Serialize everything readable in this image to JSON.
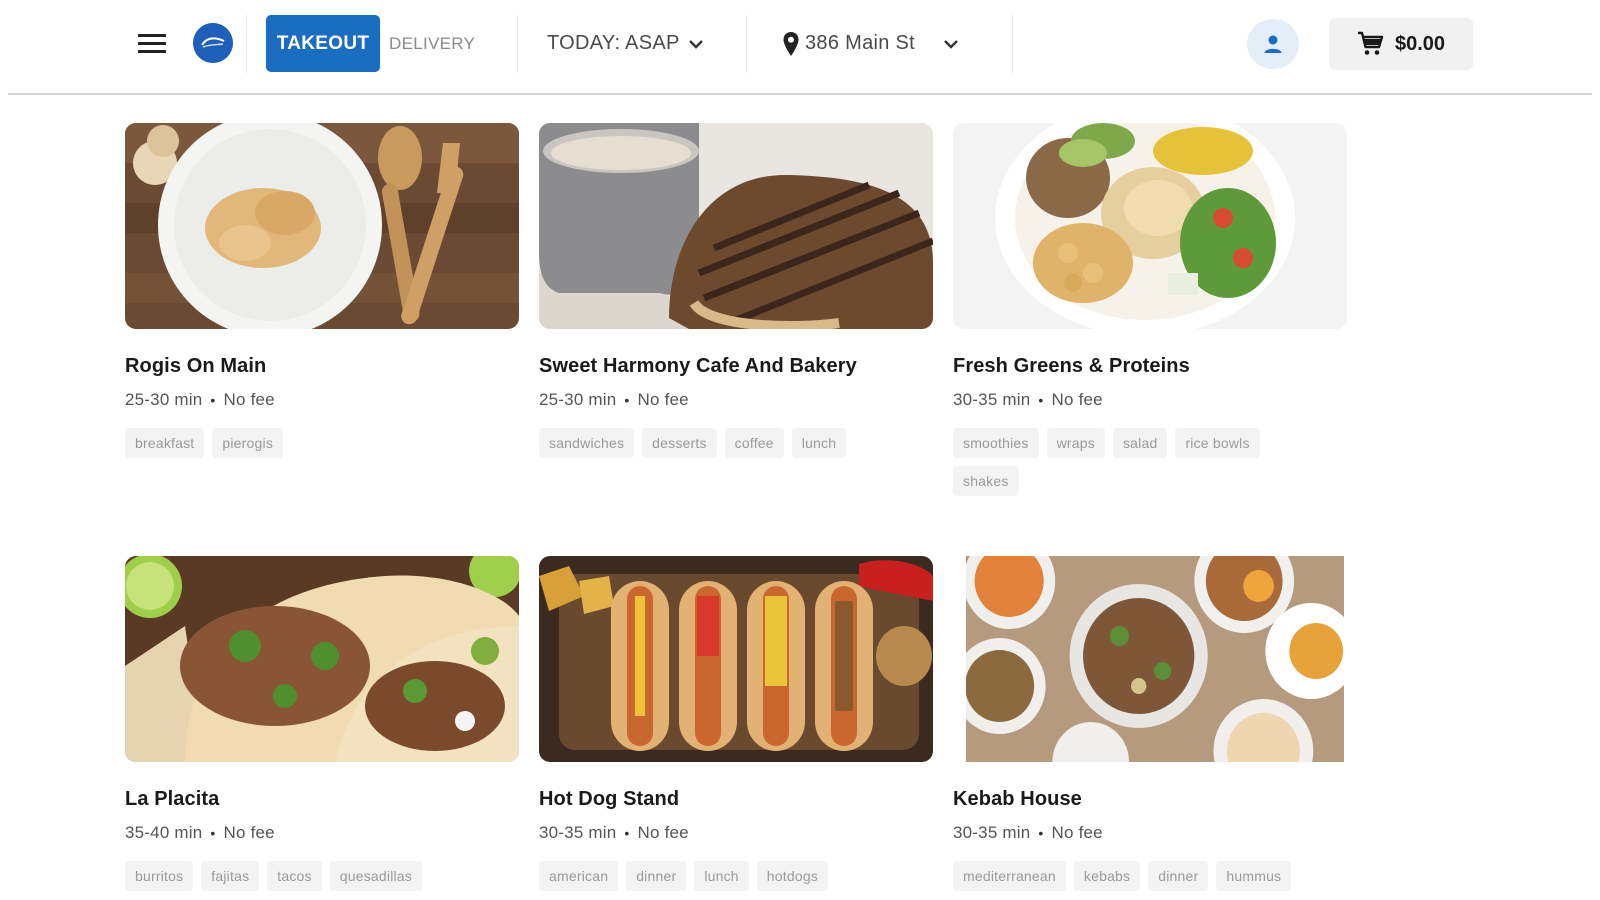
{
  "header": {
    "takeout_label": "TAKEOUT",
    "delivery_label": "DELIVERY",
    "time_label": "TODAY: ASAP",
    "address_label": "386 Main St",
    "cart_total": "$0.00",
    "colors": {
      "accent": "#1a6dbf",
      "logo": "#1e5fb8",
      "account_bg": "#e4eef9"
    }
  },
  "restaurants": [
    {
      "name": "Rogis On Main",
      "time": "25-30 min",
      "fee": "No fee",
      "tags": [
        "breakfast",
        "pierogis"
      ]
    },
    {
      "name": "Sweet Harmony Cafe And Bakery",
      "time": "25-30 min",
      "fee": "No fee",
      "tags": [
        "sandwiches",
        "desserts",
        "coffee",
        "lunch"
      ]
    },
    {
      "name": "Fresh Greens & Proteins",
      "time": "30-35 min",
      "fee": "No fee",
      "tags": [
        "smoothies",
        "wraps",
        "salad",
        "rice bowls",
        "shakes"
      ]
    },
    {
      "name": "La Placita",
      "time": "35-40 min",
      "fee": "No fee",
      "tags": [
        "burritos",
        "fajitas",
        "tacos",
        "quesadillas"
      ]
    },
    {
      "name": "Hot Dog Stand",
      "time": "30-35 min",
      "fee": "No fee",
      "tags": [
        "american",
        "dinner",
        "lunch",
        "hotdogs"
      ]
    },
    {
      "name": "Kebab House",
      "time": "30-35 min",
      "fee": "No fee",
      "tags": [
        "mediterranean",
        "kebabs",
        "dinner",
        "hummus"
      ]
    }
  ]
}
